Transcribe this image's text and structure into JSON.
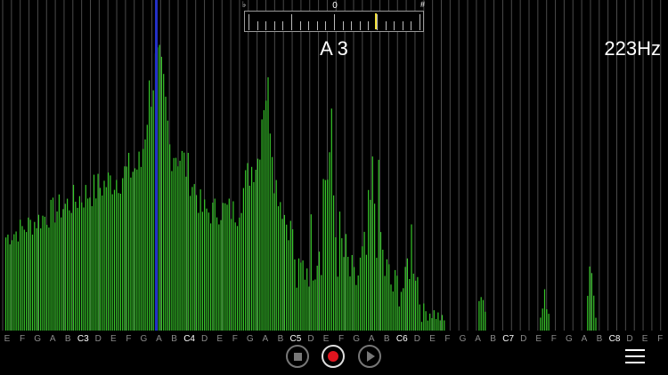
{
  "tuner": {
    "zero_label": "0",
    "flat_symbol": "♭",
    "sharp_symbol": "#",
    "needle_cents": 24,
    "needle_color": "#f2e03a"
  },
  "readout": {
    "note": "A 3",
    "frequency": "223Hz"
  },
  "note_labels": [
    "E",
    "F",
    "G",
    "A",
    "B",
    "C3",
    "D",
    "E",
    "F",
    "G",
    "A",
    "B",
    "C4",
    "D",
    "E",
    "F",
    "G",
    "A",
    "B",
    "C5",
    "D",
    "E",
    "F",
    "G",
    "A",
    "B",
    "C6",
    "D",
    "E",
    "F",
    "G",
    "A",
    "B",
    "C7",
    "D",
    "E",
    "F",
    "G",
    "A",
    "B",
    "C8",
    "D",
    "E",
    "F"
  ],
  "colors": {
    "bar_green": "#37c92a",
    "marker_blue": "#2330c8",
    "grid": "#4a4a4a",
    "record_red": "#e0141e"
  },
  "controls": {
    "stop": "stop-icon",
    "record": "record-icon",
    "play": "play-icon",
    "menu": "hamburger-menu-icon"
  }
}
